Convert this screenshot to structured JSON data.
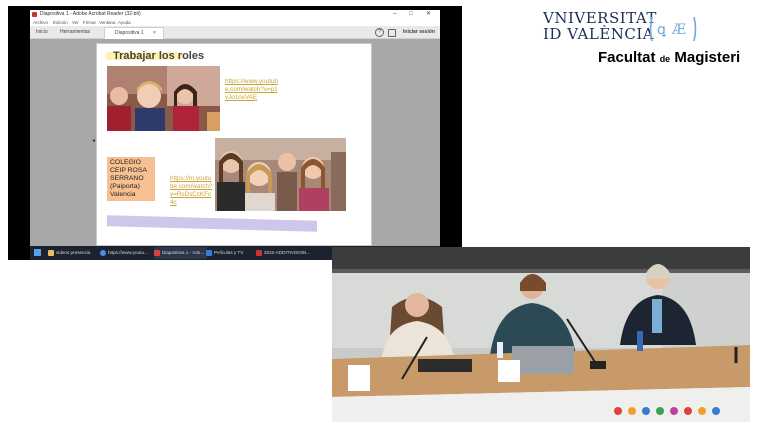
{
  "window": {
    "title": "Diapositiva 1 - Adobe Acrobat Reader (32-bit)",
    "controls": [
      "–",
      "□",
      "✕"
    ]
  },
  "menu": [
    "Archivo",
    "Edición",
    "Ver",
    "Firmar",
    "Ventana",
    "Ayuda"
  ],
  "toolbar": {
    "home": "Inicio",
    "tools": "Herramientas",
    "tab_label": "Diapositiva 1",
    "tab_close": "×",
    "help": "?",
    "signin": "Iniciar sesión"
  },
  "slide": {
    "title": "Trabajar los roles",
    "link1": "https://www.youtube.com/watch?v=p1vJo1nxVAE",
    "link2": "https://m.youtube.com/watch?v=RsDsCcKFc4c",
    "school_lines": [
      "COLEGIO",
      "CEIP ROSA",
      "SERRANO",
      "(Paiporta)",
      "Valencia"
    ]
  },
  "taskbar": {
    "items": [
      {
        "label": "videos presencia",
        "icon_color": "#e8c15a"
      },
      {
        "label": "https://www.youtu...",
        "icon_color": "#4a8cf0"
      },
      {
        "label": "Diapositiva 1 - Ado...",
        "icon_color": "#d9413a"
      },
      {
        "label": "Películas y TV",
        "icon_color": "#2f7fd9"
      },
      {
        "label": "2022-ADDITIVISION...",
        "icon_color": "#c9352e"
      }
    ],
    "time": "19:50",
    "date": "29/11/2022"
  },
  "logo": {
    "line1": "VNIVERSITAT",
    "line2": "ID VALÈNCIA",
    "faculty_a": "Facultat",
    "faculty_de": "de",
    "faculty_b": "Magisteri"
  },
  "colors": {
    "link": "#c9a43a",
    "school_box": "#f7c090",
    "slide_bar": "#cfc6ec",
    "logo_blue": "#1c2e55",
    "seal": "#6fa7d8"
  }
}
